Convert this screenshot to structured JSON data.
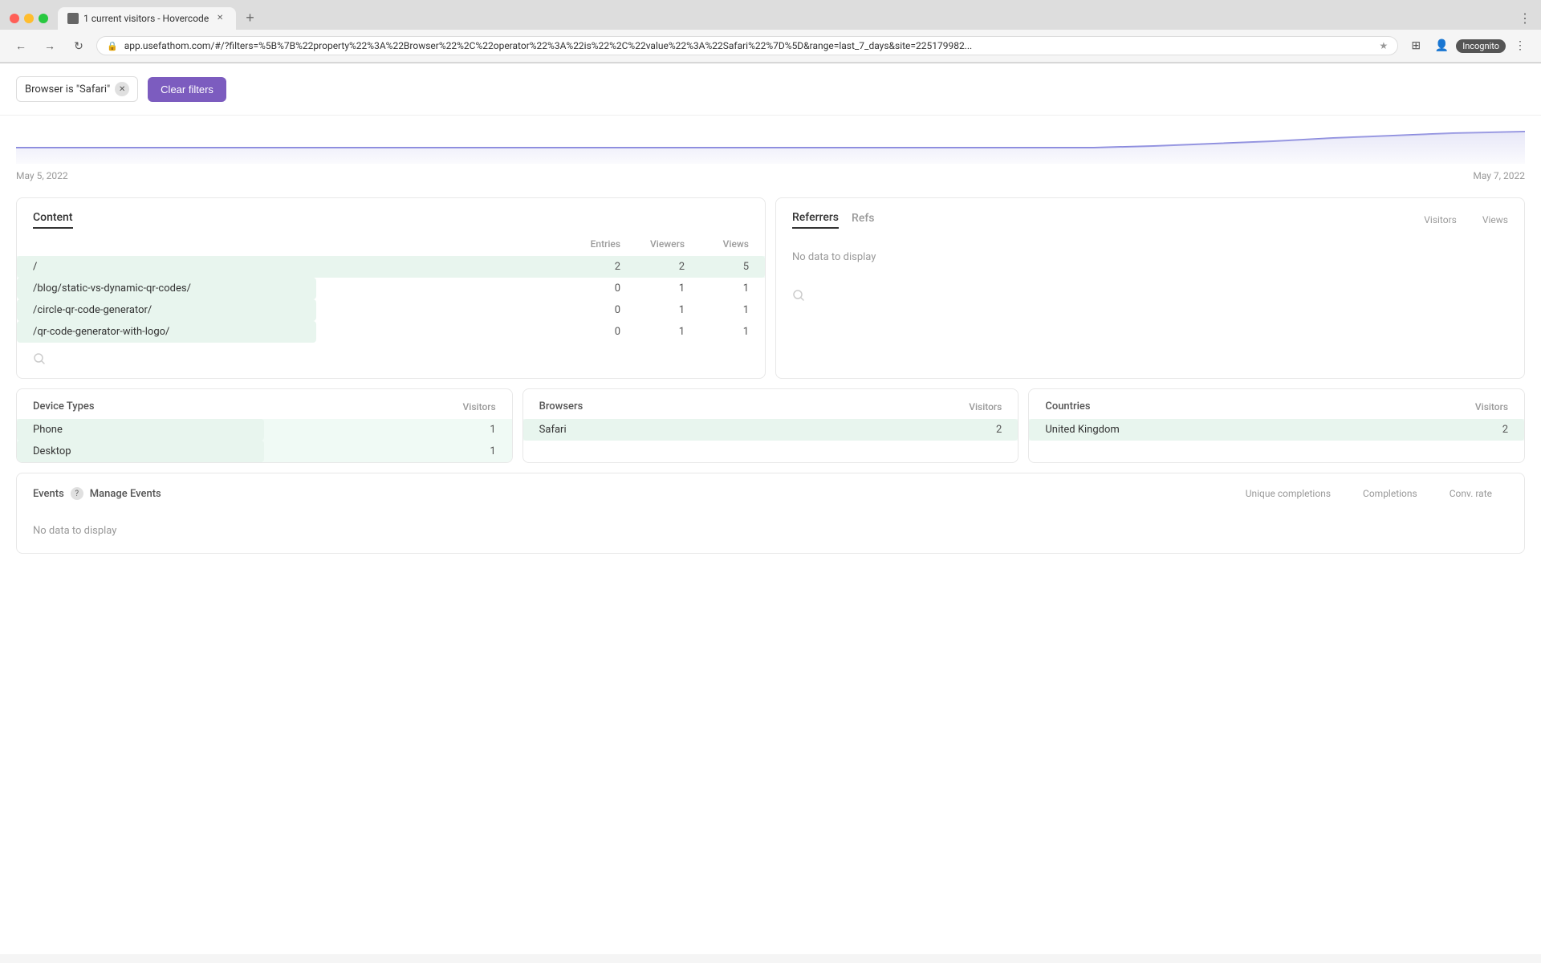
{
  "browser": {
    "traffic_lights": [
      "red",
      "yellow",
      "green"
    ],
    "tab_title": "1 current visitors - Hovercode",
    "tab_favicon": "🔖",
    "address": "app.usefathom.com/#/?filters=%5B%7B%22property%22%3A%22Browser%22%2C%22operator%22%3A%22is%22%2C%22value%22%3A%22Safari%22%7D%5D&range=last_7_days&site=225179982...",
    "incognito_label": "Incognito",
    "nav_buttons": [
      "←",
      "→",
      "↻"
    ]
  },
  "filter": {
    "tag_text": "Browser is \"Safari\"",
    "clear_label": "Clear filters"
  },
  "chart": {
    "date_left": "May 5, 2022",
    "date_right": "May 7, 2022"
  },
  "content_panel": {
    "tabs": [
      "Content",
      "Entries",
      "Viewers",
      "Views"
    ],
    "active_tab": "Content",
    "cols": {
      "main": "",
      "entries": "Entries",
      "viewers": "Viewers",
      "views": "Views"
    },
    "rows": [
      {
        "path": "/",
        "entries": "2",
        "viewers": "2",
        "views": "5",
        "highlight": true,
        "bar_pct": 100
      },
      {
        "path": "/blog/static-vs-dynamic-qr-codes/",
        "entries": "0",
        "viewers": "1",
        "views": "1",
        "highlight": false,
        "bar_pct": 40
      },
      {
        "path": "/circle-qr-code-generator/",
        "entries": "0",
        "viewers": "1",
        "views": "1",
        "highlight": false,
        "bar_pct": 40
      },
      {
        "path": "/qr-code-generator-with-logo/",
        "entries": "0",
        "viewers": "1",
        "views": "1",
        "highlight": false,
        "bar_pct": 40
      }
    ]
  },
  "referrers_panel": {
    "tabs": [
      "Referrers",
      "Refs"
    ],
    "active_tab": "Referrers",
    "cols": {
      "visitors": "Visitors",
      "views": "Views"
    },
    "no_data": "No data to display"
  },
  "device_panel": {
    "title": "Device Types",
    "col": "Visitors",
    "rows": [
      {
        "label": "Phone",
        "value": "1",
        "bar_pct": 50,
        "highlight": true
      },
      {
        "label": "Desktop",
        "value": "1",
        "bar_pct": 50,
        "highlight": true
      }
    ]
  },
  "browsers_panel": {
    "title": "Browsers",
    "col": "Visitors",
    "rows": [
      {
        "label": "Safari",
        "value": "2",
        "bar_pct": 100,
        "highlight": true
      }
    ]
  },
  "countries_panel": {
    "title": "Countries",
    "col": "Visitors",
    "rows": [
      {
        "label": "United Kingdom",
        "value": "2",
        "bar_pct": 100,
        "highlight": true
      }
    ]
  },
  "events_panel": {
    "title": "Events",
    "manage_label": "Manage Events",
    "cols": [
      "Unique completions",
      "Completions",
      "Conv. rate"
    ],
    "no_data": "No data to display"
  }
}
